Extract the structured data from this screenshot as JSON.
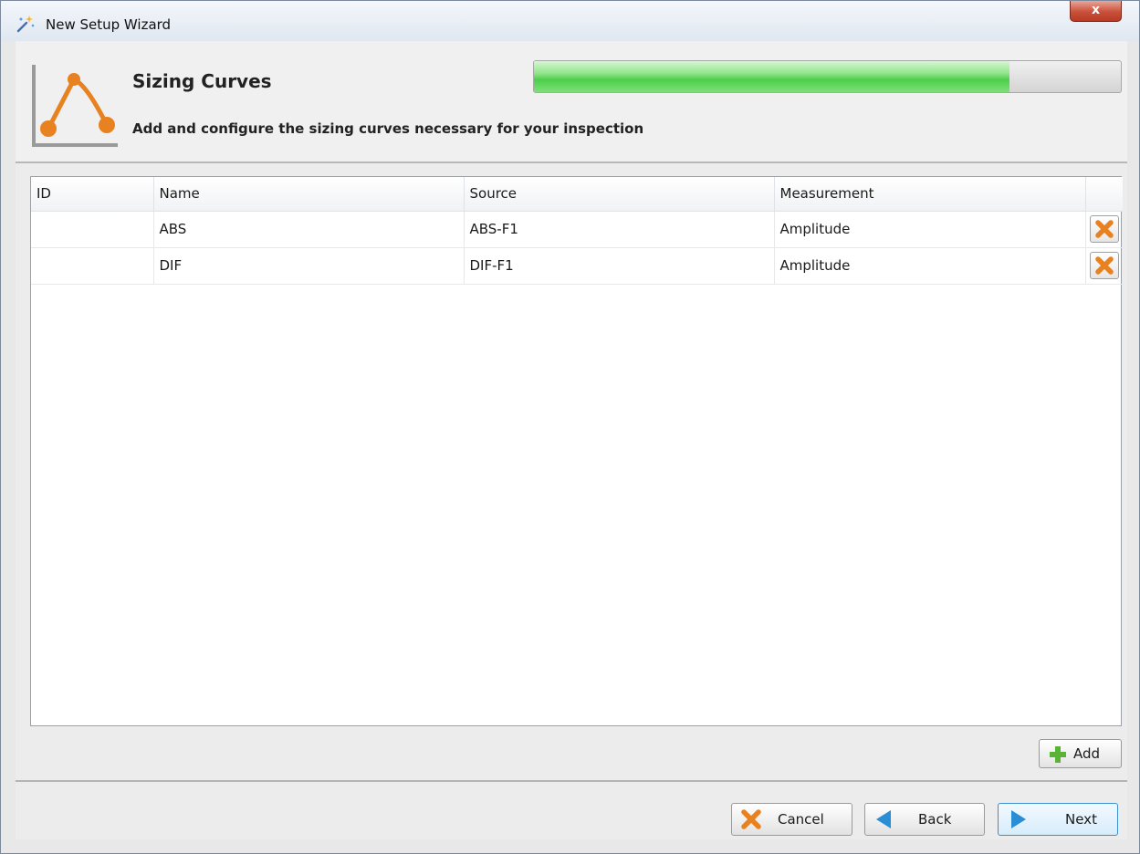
{
  "window": {
    "title": "New Setup Wizard",
    "close_label": "x"
  },
  "header": {
    "heading": "Sizing Curves",
    "subtitle": "Add and configure the sizing curves necessary for your inspection",
    "progress_fraction": 0.81,
    "accent_color": "#e8811f",
    "progress_color": "#4ccf48"
  },
  "table": {
    "columns": [
      "ID",
      "Name",
      "Source",
      "Measurement"
    ],
    "rows": [
      {
        "id": "",
        "name": "ABS",
        "source": "ABS-F1",
        "measurement": "Amplitude"
      },
      {
        "id": "",
        "name": "DIF",
        "source": "DIF-F1",
        "measurement": "Amplitude"
      }
    ]
  },
  "actions": {
    "add_label": "Add"
  },
  "footer": {
    "cancel_label": "Cancel",
    "back_label": "Back",
    "next_label": "Next"
  },
  "icons": {
    "wand": "wand-icon",
    "curve": "sizing-curve-icon",
    "delete": "delete-x-icon",
    "add": "plus-icon",
    "back": "arrow-left-icon",
    "next": "arrow-right-icon"
  }
}
